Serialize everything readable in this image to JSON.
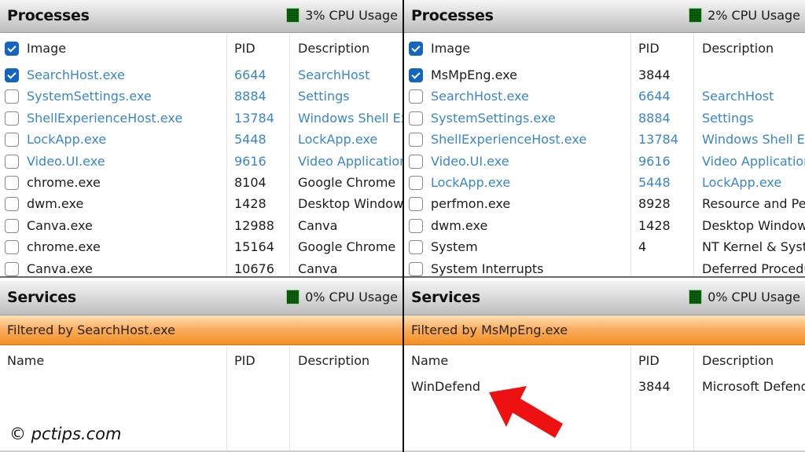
{
  "left_panel": {
    "processes": {
      "title": "Processes",
      "cpu_usage": "3% CPU Usage",
      "columns": {
        "image": "Image",
        "pid": "PID",
        "description": "Description"
      },
      "header_checked": true,
      "rows": [
        {
          "image": "SearchHost.exe",
          "pid": "6644",
          "description": "SearchHost",
          "checked": true,
          "style": "blue"
        },
        {
          "image": "SystemSettings.exe",
          "pid": "8884",
          "description": "Settings",
          "checked": false,
          "style": "blue"
        },
        {
          "image": "ShellExperienceHost.exe",
          "pid": "13784",
          "description": "Windows Shell Experience Host",
          "checked": false,
          "style": "blue"
        },
        {
          "image": "LockApp.exe",
          "pid": "5448",
          "description": "LockApp.exe",
          "checked": false,
          "style": "blue"
        },
        {
          "image": "Video.UI.exe",
          "pid": "9616",
          "description": "Video Application",
          "checked": false,
          "style": "blue"
        },
        {
          "image": "chrome.exe",
          "pid": "8104",
          "description": "Google Chrome",
          "checked": false,
          "style": "black"
        },
        {
          "image": "dwm.exe",
          "pid": "1428",
          "description": "Desktop Window Manager",
          "checked": false,
          "style": "black"
        },
        {
          "image": "Canva.exe",
          "pid": "12988",
          "description": "Canva",
          "checked": false,
          "style": "black"
        },
        {
          "image": "chrome.exe",
          "pid": "15164",
          "description": "Google Chrome",
          "checked": false,
          "style": "black"
        },
        {
          "image": "Canva.exe",
          "pid": "10676",
          "description": "Canva",
          "checked": false,
          "style": "black"
        }
      ]
    },
    "services": {
      "title": "Services",
      "cpu_usage": "0% CPU Usage",
      "filter_text": "Filtered by SearchHost.exe",
      "columns": {
        "name": "Name",
        "pid": "PID",
        "description": "Description"
      },
      "rows": []
    }
  },
  "right_panel": {
    "processes": {
      "title": "Processes",
      "cpu_usage": "2% CPU Usage",
      "columns": {
        "image": "Image",
        "pid": "PID",
        "description": "Description"
      },
      "header_checked": true,
      "rows": [
        {
          "image": "MsMpEng.exe",
          "pid": "3844",
          "description": "",
          "checked": true,
          "style": "black"
        },
        {
          "image": "SearchHost.exe",
          "pid": "6644",
          "description": "SearchHost",
          "checked": false,
          "style": "blue"
        },
        {
          "image": "SystemSettings.exe",
          "pid": "8884",
          "description": "Settings",
          "checked": false,
          "style": "blue"
        },
        {
          "image": "ShellExperienceHost.exe",
          "pid": "13784",
          "description": "Windows Shell Experience Host",
          "checked": false,
          "style": "blue"
        },
        {
          "image": "Video.UI.exe",
          "pid": "9616",
          "description": "Video Application",
          "checked": false,
          "style": "blue"
        },
        {
          "image": "LockApp.exe",
          "pid": "5448",
          "description": "LockApp.exe",
          "checked": false,
          "style": "blue"
        },
        {
          "image": "perfmon.exe",
          "pid": "8928",
          "description": "Resource and Performance Monitor",
          "checked": false,
          "style": "black"
        },
        {
          "image": "dwm.exe",
          "pid": "1428",
          "description": "Desktop Window Manager",
          "checked": false,
          "style": "black"
        },
        {
          "image": "System",
          "pid": "4",
          "description": "NT Kernel & System",
          "checked": false,
          "style": "black"
        },
        {
          "image": "System Interrupts",
          "pid": "",
          "description": "Deferred Procedure Calls",
          "checked": false,
          "style": "black"
        }
      ]
    },
    "services": {
      "title": "Services",
      "cpu_usage": "0% CPU Usage",
      "filter_text": "Filtered by MsMpEng.exe",
      "columns": {
        "name": "Name",
        "pid": "PID",
        "description": "Description"
      },
      "rows": [
        {
          "name": "WinDefend",
          "pid": "3844",
          "description": "Microsoft Defender Antivirus Service"
        }
      ]
    }
  },
  "watermark": "© pctips.com",
  "annotation": {
    "type": "arrow",
    "color": "#ee1111",
    "points_to": "WinDefend"
  },
  "colors": {
    "link_blue": "#3a86c6",
    "checkbox_blue": "#1565c0",
    "cpu_meter_green": "#0a6a0a",
    "filter_orange": "#f38f23"
  }
}
